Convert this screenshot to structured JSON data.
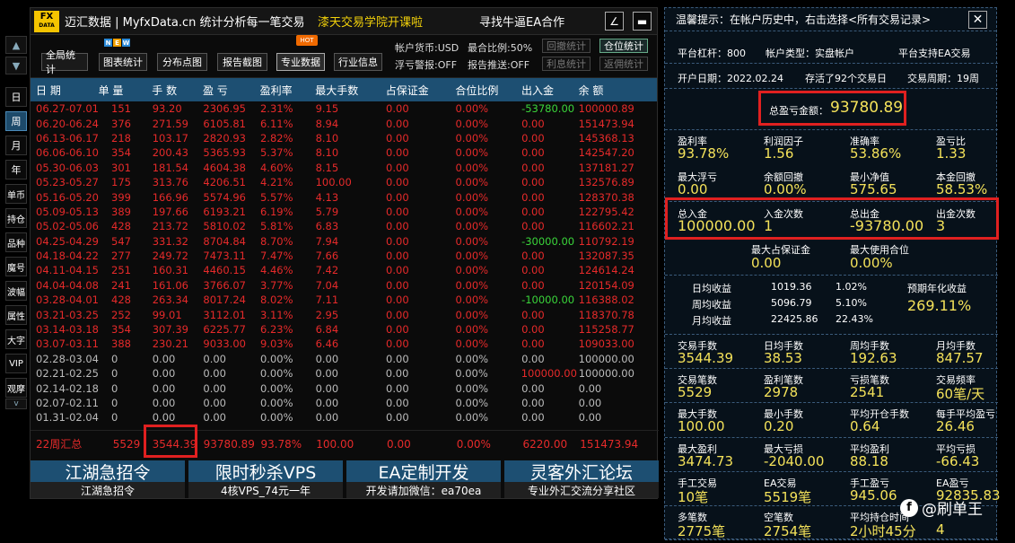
{
  "window": {
    "logo_top": "FX",
    "logo_bottom": "DATA",
    "title": "迈汇数据 | MyfxData.cn  统计分析每一笔交易",
    "promo": "漆天交易学院开课啦",
    "seek": "寻找牛逼EA合作",
    "edit_icon": "∠",
    "minimize_icon": "▬"
  },
  "side_tabs": [
    "日",
    "周",
    "月",
    "年",
    "单币",
    "持仓",
    "品种",
    "魔号",
    "波幅",
    "属性",
    "大字",
    "VIP",
    "观摩"
  ],
  "side_arrows": {
    "up": "▲",
    "down": "▼",
    "more": "v"
  },
  "toolbar": {
    "buttons": [
      "全局统计",
      "图表统计",
      "分布点图",
      "报告截图",
      "专业数据",
      "行业信息"
    ],
    "new_badge": [
      "N",
      "E",
      "W"
    ],
    "hot_badge": "HOT",
    "account_currency": "帐户货币:USD",
    "leverage_ratio": "最合比例:50%",
    "float_alert": "浮亏警报:OFF",
    "report_push": "报告推送:OFF",
    "side_buttons": [
      "回撤统计",
      "仓位统计",
      "利息统计",
      "返佣统计"
    ]
  },
  "table": {
    "headers": [
      "日 期",
      "单 量",
      "手 数",
      "盈 亏",
      "盈利率",
      "最大手数",
      "占保证金",
      "合位比例",
      "出入金",
      "余 额"
    ],
    "rows": [
      [
        "06.27-07.01",
        "151",
        "93.20",
        "2306.95",
        "2.31%",
        "9.15",
        "0.00",
        "0.00%",
        "-53780.00",
        "100000.89"
      ],
      [
        "06.20-06.24",
        "376",
        "271.59",
        "6105.81",
        "6.11%",
        "8.94",
        "0.00",
        "0.00%",
        "0.00",
        "151473.94"
      ],
      [
        "06.13-06.17",
        "218",
        "103.17",
        "2820.93",
        "2.82%",
        "8.10",
        "0.00",
        "0.00%",
        "0.00",
        "145368.13"
      ],
      [
        "06.06-06.10",
        "354",
        "200.43",
        "5365.93",
        "5.37%",
        "8.10",
        "0.00",
        "0.00%",
        "0.00",
        "142547.20"
      ],
      [
        "05.30-06.03",
        "301",
        "181.54",
        "4604.38",
        "4.60%",
        "8.15",
        "0.00",
        "0.00%",
        "0.00",
        "137181.27"
      ],
      [
        "05.23-05.27",
        "175",
        "313.76",
        "4206.51",
        "4.21%",
        "100.00",
        "0.00",
        "0.00%",
        "0.00",
        "132576.89"
      ],
      [
        "05.16-05.20",
        "399",
        "166.96",
        "5574.96",
        "5.57%",
        "4.13",
        "0.00",
        "0.00%",
        "0.00",
        "128370.38"
      ],
      [
        "05.09-05.13",
        "389",
        "197.66",
        "6193.21",
        "6.19%",
        "5.79",
        "0.00",
        "0.00%",
        "0.00",
        "122795.42"
      ],
      [
        "05.02-05.06",
        "428",
        "213.72",
        "5810.02",
        "5.81%",
        "6.83",
        "0.00",
        "0.00%",
        "0.00",
        "116602.21"
      ],
      [
        "04.25-04.29",
        "547",
        "331.32",
        "8704.84",
        "8.70%",
        "7.94",
        "0.00",
        "0.00%",
        "-30000.00",
        "110792.19"
      ],
      [
        "04.18-04.22",
        "277",
        "249.72",
        "7473.11",
        "7.47%",
        "7.66",
        "0.00",
        "0.00%",
        "0.00",
        "132087.35"
      ],
      [
        "04.11-04.15",
        "251",
        "160.31",
        "4460.15",
        "4.46%",
        "7.42",
        "0.00",
        "0.00%",
        "0.00",
        "124614.24"
      ],
      [
        "04.04-04.08",
        "241",
        "161.06",
        "3766.07",
        "3.77%",
        "7.04",
        "0.00",
        "0.00%",
        "0.00",
        "120154.09"
      ],
      [
        "03.28-04.01",
        "428",
        "263.34",
        "8017.24",
        "8.02%",
        "7.11",
        "0.00",
        "0.00%",
        "-10000.00",
        "116388.02"
      ],
      [
        "03.21-03.25",
        "252",
        "99.01",
        "3112.01",
        "3.11%",
        "2.95",
        "0.00",
        "0.00%",
        "0.00",
        "118370.78"
      ],
      [
        "03.14-03.18",
        "354",
        "307.39",
        "6225.77",
        "6.23%",
        "6.84",
        "0.00",
        "0.00%",
        "0.00",
        "115258.77"
      ],
      [
        "03.07-03.11",
        "388",
        "230.21",
        "9033.00",
        "9.03%",
        "6.46",
        "0.00",
        "0.00%",
        "0.00",
        "109033.00"
      ],
      [
        "02.28-03.04",
        "0",
        "0.00",
        "0.00",
        "0.00%",
        "0.00",
        "0.00",
        "0.00%",
        "0.00",
        "100000.00"
      ],
      [
        "02.21-02.25",
        "0",
        "0.00",
        "0.00",
        "0.00%",
        "0.00",
        "0.00",
        "0.00%",
        "100000.00",
        "100000.00"
      ],
      [
        "02.14-02.18",
        "0",
        "0.00",
        "0.00",
        "0.00%",
        "0.00",
        "0.00",
        "0.00%",
        "0.00",
        "0.00"
      ],
      [
        "02.07-02.11",
        "0",
        "0.00",
        "0.00",
        "0.00%",
        "0.00",
        "0.00",
        "0.00%",
        "0.00",
        "0.00"
      ],
      [
        "01.31-02.04",
        "0",
        "0.00",
        "0.00",
        "0.00%",
        "0.00",
        "0.00",
        "0.00%",
        "0.00",
        "0.00"
      ]
    ],
    "row_colors": [
      "red",
      "red",
      "red",
      "red",
      "red",
      "red",
      "red",
      "red",
      "red",
      "red",
      "red",
      "red",
      "red",
      "red",
      "red",
      "red",
      "red",
      "gry",
      "gry",
      "gry",
      "gry",
      "gry"
    ],
    "summary": [
      "22周汇总",
      "5529",
      "3544.39",
      "93780.89",
      "93.78%",
      "100.00",
      "0.00",
      "0.00%",
      "6220.00",
      "151473.94"
    ]
  },
  "promos": [
    {
      "title": "江湖急招令",
      "sub": "江湖急招令"
    },
    {
      "title": "限时秒杀VPS",
      "sub": "4核VPS_74元一年"
    },
    {
      "title": "EA定制开发",
      "sub": "开发请加微信：ea70ea"
    },
    {
      "title": "灵客外汇论坛",
      "sub": "专业外汇交流分享社区"
    }
  ],
  "right": {
    "hint": "温馨提示：在帐户历史中，右击选择<所有交易记录>",
    "close_icon": "✕",
    "platform_leverage": "平台杠杆：800",
    "account_type": "帐户类型：实盘帐户",
    "ea_support": "平台支持EA交易",
    "open_date": "开户日期：2022.02.24",
    "survival": "存活了92个交易日",
    "trade_cycle": "交易周期：19周",
    "total_pl_label": "总盈亏金额：",
    "total_pl_value": "93780.89",
    "stats1": [
      [
        "盈利率",
        "93.78%"
      ],
      [
        "利润因子",
        "1.56"
      ],
      [
        "准确率",
        "53.86%"
      ],
      [
        "盈亏比",
        "1.33"
      ],
      [
        "最大浮亏",
        "0.00"
      ],
      [
        "余额回撤",
        "0.00%"
      ],
      [
        "最小净值",
        "575.65"
      ],
      [
        "本金回撤",
        "58.53%"
      ]
    ],
    "funds": [
      [
        "总入金",
        "100000.00"
      ],
      [
        "入金次数",
        "1"
      ],
      [
        "总出金",
        "-93780.00"
      ],
      [
        "出金次数",
        "3"
      ]
    ],
    "margin": [
      [
        "最大占保证金",
        "0.00"
      ],
      [
        "最大使用合位",
        "0.00%"
      ]
    ],
    "earnings": [
      [
        "日均收益",
        "1019.36",
        "1.02%"
      ],
      [
        "周均收益",
        "5096.79",
        "5.10%"
      ],
      [
        "月均收益",
        "22425.86",
        "22.43%"
      ]
    ],
    "annual_label": "预期年化收益",
    "annual_value": "269.11%",
    "stats2": [
      [
        "交易手数",
        "3544.39"
      ],
      [
        "日均手数",
        "38.53"
      ],
      [
        "周均手数",
        "192.63"
      ],
      [
        "月均手数",
        "847.57"
      ],
      [
        "交易笔数",
        "5529"
      ],
      [
        "盈利笔数",
        "2978"
      ],
      [
        "亏损笔数",
        "2541"
      ],
      [
        "交易频率",
        "60笔/天"
      ],
      [
        "最大手数",
        "100.00"
      ],
      [
        "最小手数",
        "0.20"
      ],
      [
        "平均开仓手数",
        "0.64"
      ],
      [
        "每手平均盈亏",
        "26.46"
      ],
      [
        "最大盈利",
        "3474.73"
      ],
      [
        "最大亏损",
        "-2040.00"
      ],
      [
        "平均盈利",
        "88.18"
      ],
      [
        "平均亏损",
        "-66.43"
      ],
      [
        "手工交易",
        "10笔"
      ],
      [
        "EA交易",
        "5519笔"
      ],
      [
        "手工盈亏",
        "945.06"
      ],
      [
        "EA盈亏",
        "92835.83"
      ],
      [
        "多笔数",
        "2775笔"
      ],
      [
        "空笔数",
        "2754笔"
      ],
      [
        "平均持仓时间",
        "2小时45分"
      ],
      [
        "",
        "4"
      ]
    ],
    "watermark_icon": "f",
    "watermark": "@刷单王"
  }
}
